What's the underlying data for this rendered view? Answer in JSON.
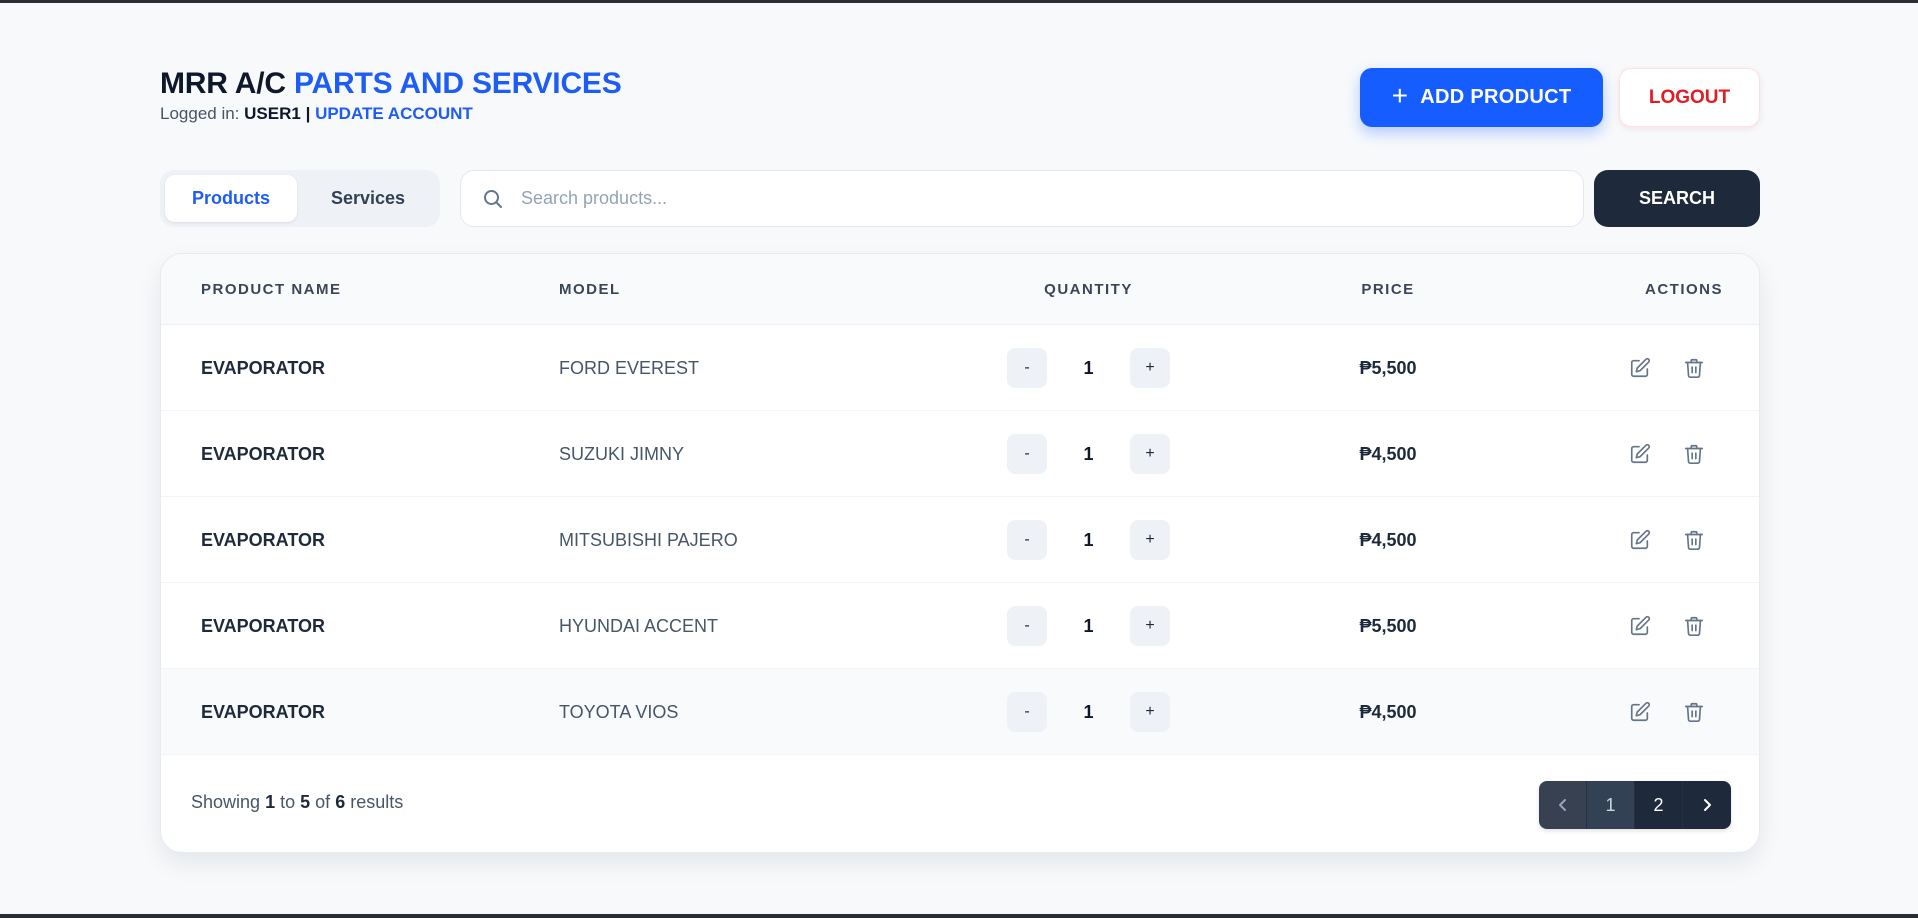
{
  "header": {
    "title_main": "MRR A/C",
    "title_accent": "PARTS AND SERVICES",
    "logged_in_label": "Logged in:",
    "username": "USER1",
    "separator": "|",
    "update_account": "UPDATE ACCOUNT",
    "add_product": "ADD PRODUCT",
    "add_icon": "plus-icon",
    "logout": "LOGOUT"
  },
  "tabs": [
    {
      "label": "Products",
      "active": true
    },
    {
      "label": "Services",
      "active": false
    }
  ],
  "search": {
    "placeholder": "Search products...",
    "value": "",
    "icon": "search-icon",
    "button": "SEARCH"
  },
  "table": {
    "columns": [
      "PRODUCT NAME",
      "MODEL",
      "QUANTITY",
      "PRICE",
      "ACTIONS"
    ],
    "rows": [
      {
        "name": "EVAPORATOR",
        "model": "FORD EVEREST",
        "qty": "1",
        "price": "₱5,500"
      },
      {
        "name": "EVAPORATOR",
        "model": "SUZUKI JIMNY",
        "qty": "1",
        "price": "₱4,500"
      },
      {
        "name": "EVAPORATOR",
        "model": "MITSUBISHI PAJERO",
        "qty": "1",
        "price": "₱4,500"
      },
      {
        "name": "EVAPORATOR",
        "model": "HYUNDAI ACCENT",
        "qty": "1",
        "price": "₱5,500"
      },
      {
        "name": "EVAPORATOR",
        "model": "TOYOTA VIOS",
        "qty": "1",
        "price": "₱4,500"
      }
    ],
    "qty_minus": "-",
    "qty_plus": "+",
    "action_icons": [
      "edit-icon",
      "trash-icon"
    ]
  },
  "footer": {
    "showing_prefix": "Showing",
    "from": "1",
    "to_word": "to",
    "to": "5",
    "of_word": "of",
    "total": "6",
    "results_word": "results",
    "pages": [
      "1",
      "2"
    ],
    "current_page": "2"
  },
  "colors": {
    "accent": "#1d5cf5",
    "add_button": "#165dff",
    "logout_text": "#e11d24",
    "dark": "#1e293b"
  }
}
